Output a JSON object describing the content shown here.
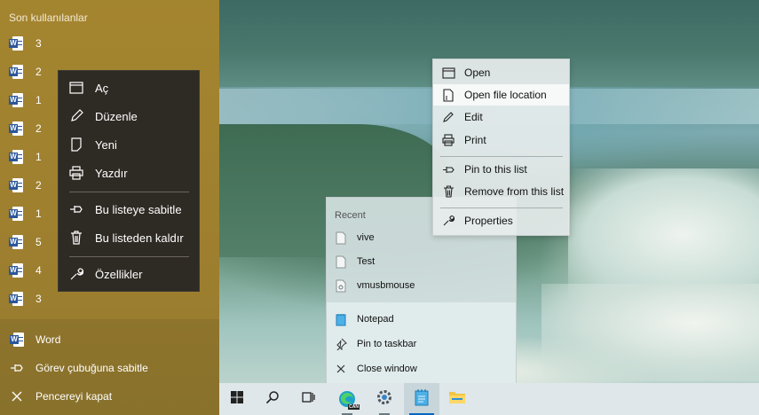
{
  "left_jumplist": {
    "header": "Son kullanılanlar",
    "recent_items": [
      "3",
      "2",
      "1",
      "2",
      "1",
      "2",
      "1",
      "5",
      "4",
      "3"
    ],
    "tasks": [
      {
        "label": "Word",
        "icon": "word-icon"
      },
      {
        "label": "Görev çubuğuna sabitle",
        "icon": "pin-icon"
      },
      {
        "label": "Pencereyi kapat",
        "icon": "close-icon"
      }
    ]
  },
  "dark_menu": {
    "items": [
      {
        "label": "Aç",
        "icon": "window-icon"
      },
      {
        "label": "Düzenle",
        "icon": "pencil-icon"
      },
      {
        "label": "Yeni",
        "icon": "new-doc-icon"
      },
      {
        "label": "Yazdır",
        "icon": "printer-icon"
      },
      {
        "label": "Bu listeye sabitle",
        "icon": "pin-icon"
      },
      {
        "label": "Bu listeden kaldır",
        "icon": "trash-icon"
      },
      {
        "label": "Özellikler",
        "icon": "wrench-icon"
      }
    ]
  },
  "light_menu": {
    "items": [
      {
        "label": "Open",
        "icon": "window-icon"
      },
      {
        "label": "Open file location",
        "icon": "file-location-icon"
      },
      {
        "label": "Edit",
        "icon": "pencil-icon"
      },
      {
        "label": "Print",
        "icon": "printer-icon"
      },
      {
        "label": "Pin to this list",
        "icon": "pin-icon"
      },
      {
        "label": "Remove from this list",
        "icon": "trash-icon"
      },
      {
        "label": "Properties",
        "icon": "wrench-icon"
      }
    ]
  },
  "recent_panel": {
    "header": "Recent",
    "items": [
      {
        "label": "vive",
        "icon": "text-file-icon"
      },
      {
        "label": "Test",
        "icon": "text-file-icon"
      },
      {
        "label": "vmusbmouse",
        "icon": "settings-file-icon"
      }
    ],
    "tasks": [
      {
        "label": "Notepad",
        "icon": "notepad-icon"
      },
      {
        "label": "Pin to taskbar",
        "icon": "pin-icon"
      },
      {
        "label": "Close window",
        "icon": "close-icon"
      }
    ]
  },
  "taskbar": {
    "buttons": [
      "start-icon",
      "search-icon",
      "task-view-icon",
      "edge-icon",
      "settings-icon",
      "notepad-icon",
      "file-explorer-icon"
    ],
    "edge_badge": "CAN"
  },
  "colors": {
    "jumplist_bg": "#9e8030",
    "dark_menu_bg": "#2e2a24",
    "light_menu_bg": "#e6ecec",
    "accent": "#0067c0",
    "word_blue": "#2b579a"
  }
}
